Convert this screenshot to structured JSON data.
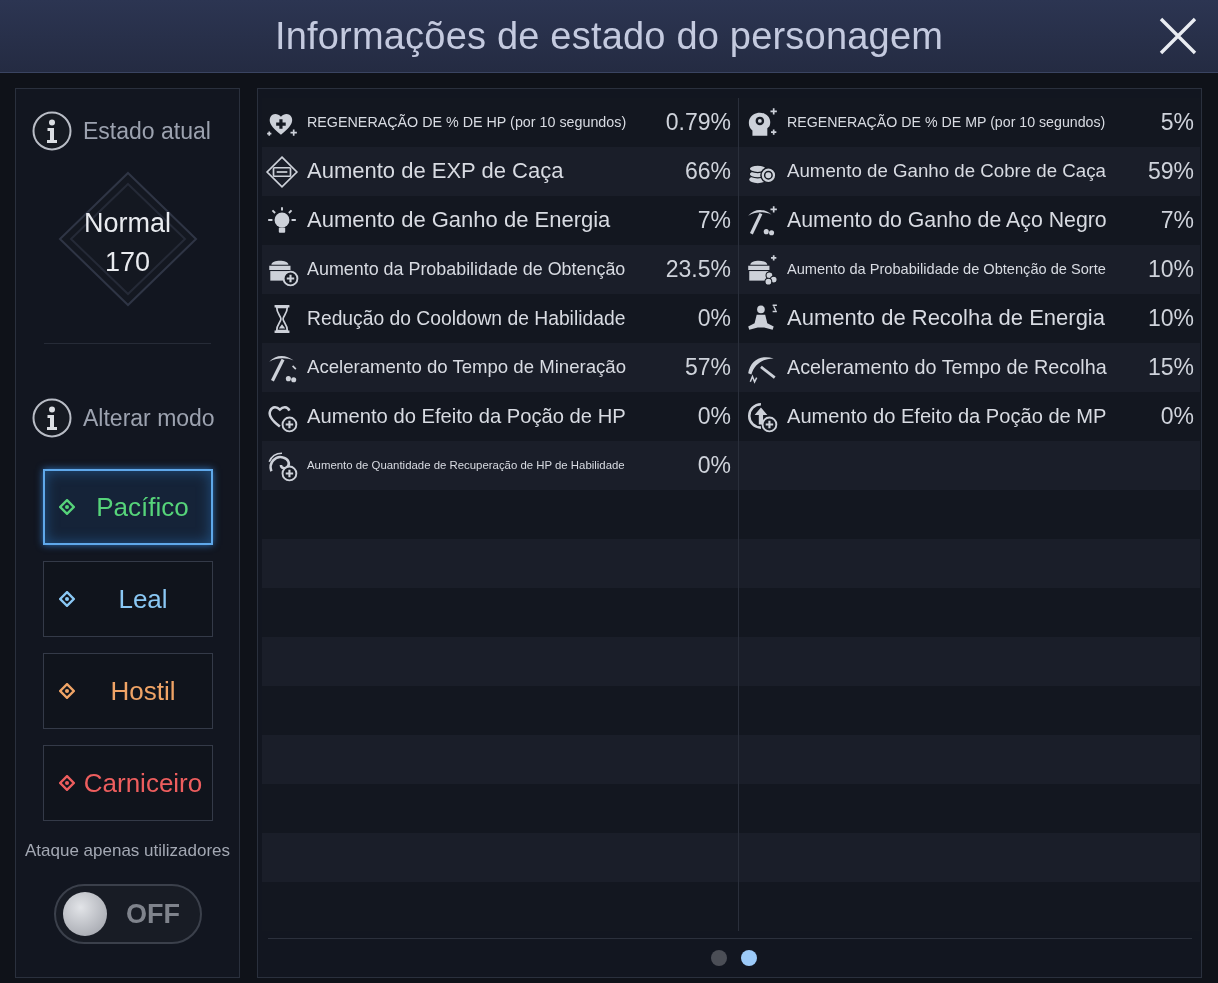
{
  "window": {
    "title": "Informações de estado do personagem"
  },
  "status_panel": {
    "heading": "Estado atual",
    "state_name": "Normal",
    "state_value": "170"
  },
  "mode_panel": {
    "heading": "Alterar modo",
    "modes": [
      {
        "label": "Pacífico",
        "color": "#56d47a",
        "selected": true
      },
      {
        "label": "Leal",
        "color": "#8ac8f4",
        "selected": false
      },
      {
        "label": "Hostil",
        "color": "#f0a466",
        "selected": false
      },
      {
        "label": "Carniceiro",
        "color": "#ee5e5e",
        "selected": false
      }
    ],
    "toggle": {
      "label": "Ataque apenas utilizadores",
      "state_text": "OFF",
      "on": false
    }
  },
  "stats": {
    "columns": [
      [
        {
          "label": "REGENERAÇÃO DE % DE HP (por 10 segundos)",
          "value": "0.79%"
        },
        {
          "label": "Aumento de EXP de Caça",
          "value": "66%"
        },
        {
          "label": "Aumento de Ganho de Energia",
          "value": "7%"
        },
        {
          "label": "Aumento da Probabilidade de Obtenção",
          "value": "23.5%"
        },
        {
          "label": "Redução do Cooldown de Habilidade",
          "value": "0%"
        },
        {
          "label": "Aceleramento do Tempo de Mineração",
          "value": "57%"
        },
        {
          "label": "Aumento do Efeito da Poção de HP",
          "value": "0%"
        },
        {
          "label": "Aumento de Quantidade de Recuperação de HP de Habilidade",
          "value": "0%"
        }
      ],
      [
        {
          "label": "REGENERAÇÃO DE % DE MP (por 10 segundos)",
          "value": "5%"
        },
        {
          "label": "Aumento de Ganho de Cobre de Caça",
          "value": "59%"
        },
        {
          "label": "Aumento do Ganho de Aço Negro",
          "value": "7%"
        },
        {
          "label": "Aumento da Probabilidade de Obtenção de Sorte",
          "value": "10%"
        },
        {
          "label": "Aumento de Recolha de Energia",
          "value": "10%"
        },
        {
          "label": "Aceleramento do Tempo de Recolha",
          "value": "15%"
        },
        {
          "label": "Aumento do Efeito da Poção de MP",
          "value": "0%"
        }
      ]
    ]
  },
  "pagination": [
    {
      "selected": false
    },
    {
      "selected": true
    }
  ]
}
